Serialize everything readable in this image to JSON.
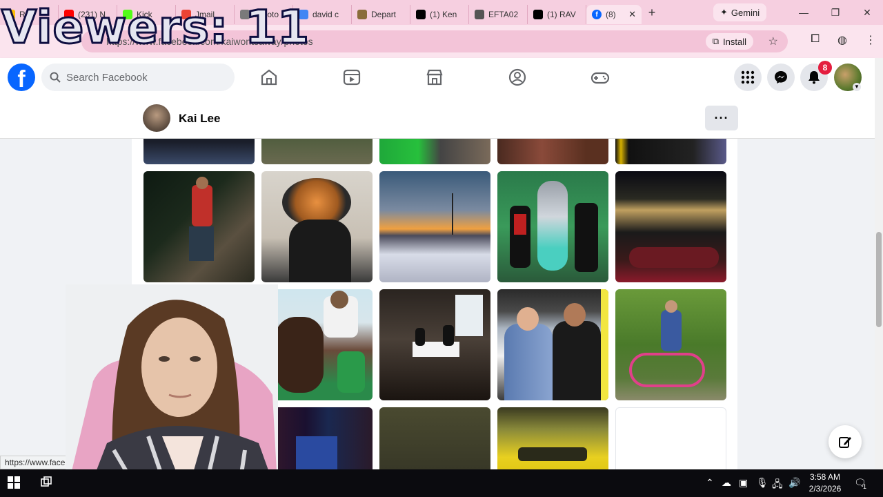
{
  "overlay": {
    "viewers_text": "Viewers: 11"
  },
  "browser": {
    "tabs": [
      {
        "label": "Re",
        "icon": "google-drive-icon",
        "color": "#fbbc04"
      },
      {
        "label": "(231) N",
        "icon": "youtube-icon",
        "color": "#ff0000"
      },
      {
        "label": "Kick",
        "icon": "kick-icon",
        "color": "#53fc18"
      },
      {
        "label": "Jmail",
        "icon": "gmail-icon",
        "color": "#ea4335"
      },
      {
        "label": "Jphoto",
        "icon": "photo-icon",
        "color": "#7a7a7a"
      },
      {
        "label": "david c",
        "icon": "google-icon",
        "color": "#4285f4"
      },
      {
        "label": "Depart",
        "icon": "seal-icon",
        "color": "#8a6d3b"
      },
      {
        "label": "(1) Ken",
        "icon": "x-icon",
        "color": "#000000"
      },
      {
        "label": "EFTA02",
        "icon": "globe-icon",
        "color": "#555555"
      },
      {
        "label": "(1) RAV",
        "icon": "x-icon",
        "color": "#000000"
      }
    ],
    "active_tab": {
      "label": "(8)",
      "icon": "facebook-icon",
      "color": "#0866ff"
    },
    "gemini_label": "Gemini",
    "url": "https://www.facebook.com/kaiwontsaway/photos",
    "install_label": "Install",
    "status_link": "https://www.facebook"
  },
  "facebook": {
    "search_placeholder": "Search Facebook",
    "notification_count": "8",
    "profile_name": "Kai Lee",
    "more_label": "···",
    "brand_color": "#0866ff"
  },
  "taskbar": {
    "time": "3:58 AM",
    "date": "2/3/2026",
    "notif_count": "1"
  }
}
